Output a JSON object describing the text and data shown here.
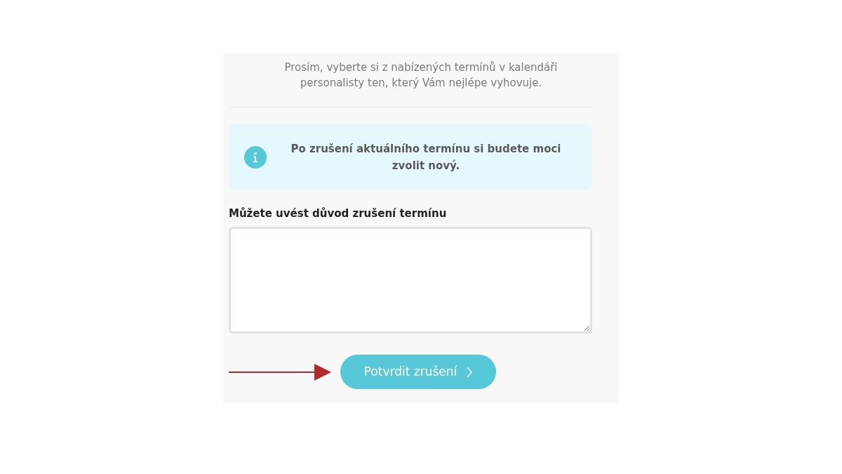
{
  "intro": {
    "text": "Prosím, vyberte si z nabízených termínů v kalendáři personalisty ten, který Vám nejlépe vyhovuje."
  },
  "notice": {
    "text": "Po zrušení aktuálního termínu si budete moci zvolit nový."
  },
  "reason_field": {
    "label": "Můžete uvést důvod zrušení termínu"
  },
  "confirm_button": {
    "label": "Potvrdit zrušení"
  }
}
